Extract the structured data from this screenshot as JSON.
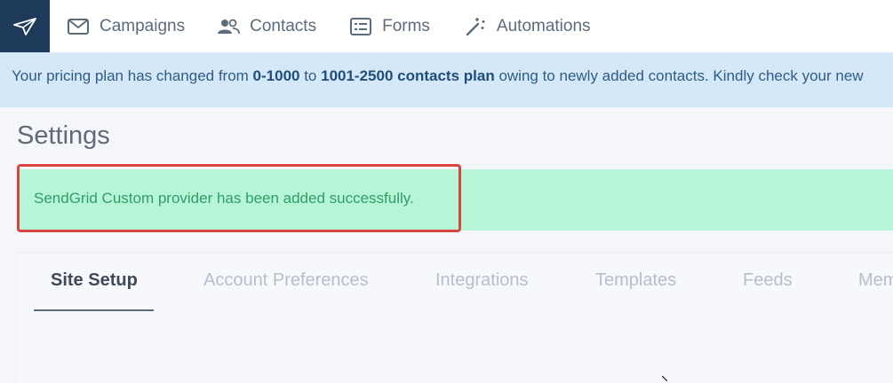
{
  "nav": {
    "items": [
      {
        "label": "Campaigns",
        "icon": "mail-icon"
      },
      {
        "label": "Contacts",
        "icon": "people-icon"
      },
      {
        "label": "Forms",
        "icon": "form-icon"
      },
      {
        "label": "Automations",
        "icon": "magic-wand-icon"
      }
    ]
  },
  "banner": {
    "prefix": "Your pricing plan has changed from ",
    "from": "0-1000",
    "mid": " to ",
    "to": "1001-2500 contacts plan",
    "suffix": " owing to newly added contacts. Kindly check your new"
  },
  "page": {
    "title": "Settings"
  },
  "alert": {
    "message": "SendGrid Custom provider has been added successfully."
  },
  "tabs": [
    {
      "label": "Site Setup",
      "active": true
    },
    {
      "label": "Account Preferences",
      "active": false
    },
    {
      "label": "Integrations",
      "active": false
    },
    {
      "label": "Templates",
      "active": false
    },
    {
      "label": "Feeds",
      "active": false
    },
    {
      "label": "Mem",
      "active": false
    }
  ],
  "colors": {
    "brand": "#1d3a5a",
    "banner_bg": "#d5e8f8",
    "alert_bg": "#b7f5d8",
    "highlight": "#d9453f"
  }
}
